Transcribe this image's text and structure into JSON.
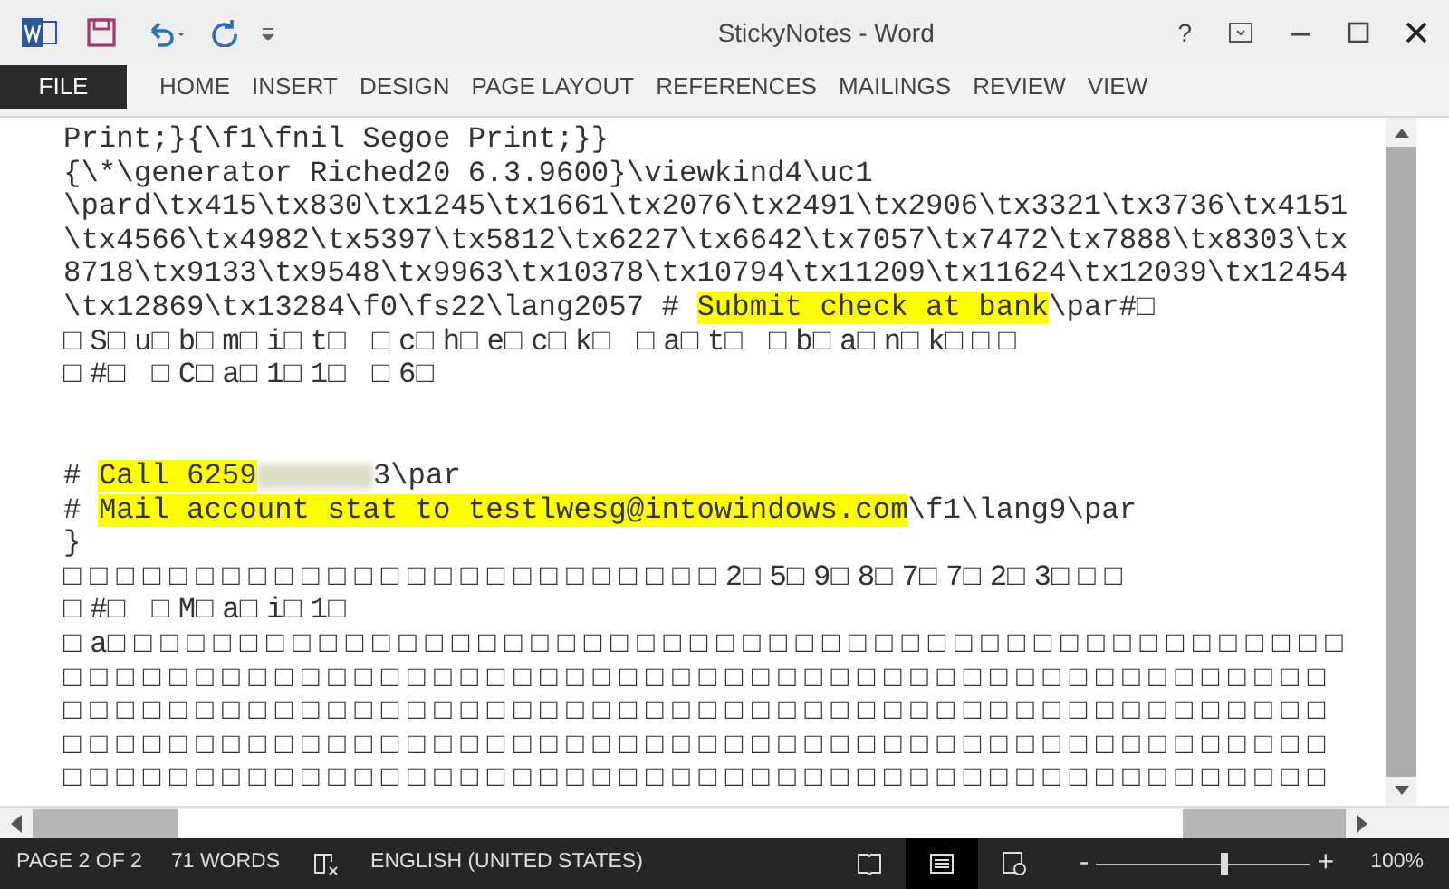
{
  "window": {
    "title": "StickyNotes - Word",
    "help": "?"
  },
  "ribbon_tabs": [
    {
      "label": "FILE",
      "kind": "file"
    },
    {
      "label": "HOME",
      "kind": "tab"
    },
    {
      "label": "INSERT",
      "kind": "tab"
    },
    {
      "label": "DESIGN",
      "kind": "tab"
    },
    {
      "label": "PAGE LAYOUT",
      "kind": "tab"
    },
    {
      "label": "REFERENCES",
      "kind": "tab"
    },
    {
      "label": "MAILINGS",
      "kind": "tab"
    },
    {
      "label": "REVIEW",
      "kind": "tab"
    },
    {
      "label": "VIEW",
      "kind": "tab"
    }
  ],
  "document_lines": [
    [
      {
        "text": "Print;}{\\f1\\fnil Segoe Print;}}",
        "highlight": false
      }
    ],
    [
      {
        "text": "{\\*\\generator Riched20 6.3.9600}\\viewkind4\\uc1",
        "highlight": false
      }
    ],
    [
      {
        "text": "\\pard\\tx415\\tx830\\tx1245\\tx1661\\tx2076\\tx2491\\tx2906\\tx3321\\tx3736\\tx4151",
        "highlight": false
      }
    ],
    [
      {
        "text": "\\tx4566\\tx4982\\tx5397\\tx5812\\tx6227\\tx6642\\tx7057\\tx7472\\tx7888\\tx8303\\tx",
        "highlight": false
      }
    ],
    [
      {
        "text": "8718\\tx9133\\tx9548\\tx9963\\tx10378\\tx10794\\tx11209\\tx11624\\tx12039\\tx12454",
        "highlight": false
      }
    ],
    [
      {
        "text": "\\tx12869\\tx13284\\f0\\fs22\\lang2057 # ",
        "highlight": false
      },
      {
        "text": "Submit check at bank",
        "highlight": true
      },
      {
        "text": "\\par#□",
        "highlight": false
      }
    ],
    [
      {
        "text": "□S□u□b□m□i□t□ □c□h□e□c□k□ □a□t□ □b□a□n□k□□□",
        "highlight": false
      }
    ],
    [
      {
        "text": "□#□ □C□a□1□1□ □6□",
        "highlight": false
      }
    ],
    [
      {
        "kind": "blank"
      }
    ],
    [
      {
        "kind": "blank"
      }
    ],
    [
      {
        "text": "# ",
        "highlight": false
      },
      {
        "text": "Call 6259",
        "highlight": true
      },
      {
        "kind": "redacted"
      },
      {
        "text": "3\\par",
        "highlight": false
      }
    ],
    [
      {
        "text": "# ",
        "highlight": false
      },
      {
        "text": "Mail account stat to testlwesg@intowindows.com",
        "highlight": true
      },
      {
        "text": "\\f1\\lang9\\par",
        "highlight": false
      }
    ],
    [
      {
        "text": "}",
        "highlight": false
      }
    ],
    [
      {
        "text": "□□□□□□□□□□□□□□□□□□□□□□□□□2□5□9□8□7□7□2□3□□□",
        "highlight": false
      }
    ],
    [
      {
        "text": "□#□ □M□a□i□1□",
        "highlight": false
      }
    ],
    [
      {
        "text": "□a□□□□□□□□□□□□□□□□□□□□□□□□□□□□□□□□□□□□□□□□□□□□□□□",
        "highlight": false
      }
    ],
    [
      {
        "text": "□□□□□□□□□□□□□□□□□□□□□□□□□□□□□□□□□□□□□□□□□□□□□□□□",
        "highlight": false
      }
    ],
    [
      {
        "text": "□□□□□□□□□□□□□□□□□□□□□□□□□□□□□□□□□□□□□□□□□□□□□□□□",
        "highlight": false
      }
    ],
    [
      {
        "text": "□□□□□□□□□□□□□□□□□□□□□□□□□□□□□□□□□□□□□□□□□□□□□□□□",
        "highlight": false
      }
    ],
    [
      {
        "text": "□□□□□□□□□□□□□□□□□□□□□□□□□□□□□□□□□□□□□□□□□□□□□□□□",
        "highlight": false
      }
    ]
  ],
  "status_bar": {
    "page": "PAGE 2 OF 2",
    "words": "71 WORDS",
    "language": "ENGLISH (UNITED STATES)",
    "views": [
      {
        "kind": "read",
        "selected": false
      },
      {
        "kind": "print",
        "selected": true
      },
      {
        "kind": "web",
        "selected": false
      }
    ],
    "zoom": {
      "minus": "-",
      "plus": "+",
      "level": 0.6,
      "reading": "100%"
    }
  }
}
